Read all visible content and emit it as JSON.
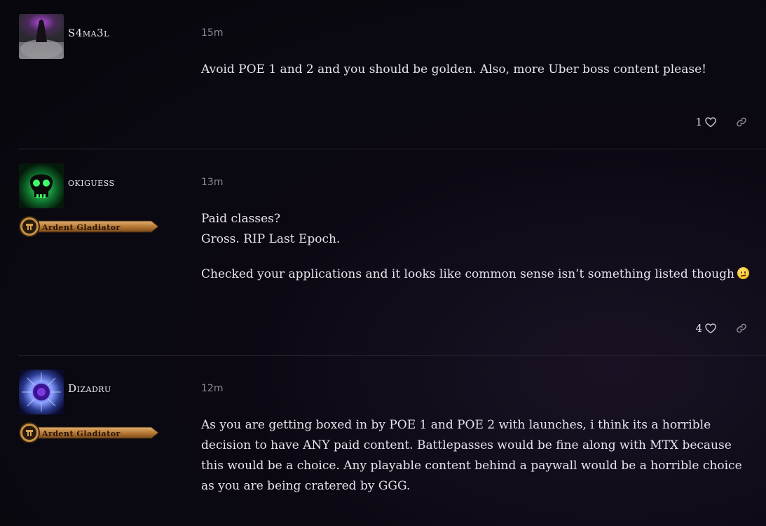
{
  "posts": [
    {
      "username": "S4ma3l",
      "time": "15m",
      "paragraphs": [
        "Avoid POE 1 and 2 and you should be golden. Also, more Uber boss content please!"
      ],
      "likes": "1",
      "avatar": "avatar-dark-figure-purple"
    },
    {
      "username": "okiguess",
      "time": "13m",
      "badge": "Ardent Gladiator",
      "paragraphs": [
        "Paid classes?",
        "Gross. RIP Last Epoch.",
        "Checked your applications and it looks like common sense isn’t something listed though"
      ],
      "likes": "4",
      "avatar": "avatar-green-skull"
    },
    {
      "username": "Dizadru",
      "time": "12m",
      "badge": "Ardent Gladiator",
      "paragraphs": [
        "As you are getting boxed in by POE 1 and POE 2 with launches, i think its a horrible decision to have ANY paid content. Battlepasses would be fine along with MTX because this would be a choice. Any playable content behind a paywall would be a horrible choice as you are being cratered by GGG."
      ],
      "avatar": "avatar-purple-orb"
    }
  ],
  "colors": {
    "background": "#0b0812",
    "divider": "#2a2530",
    "badge_gold": "#c9944a"
  }
}
